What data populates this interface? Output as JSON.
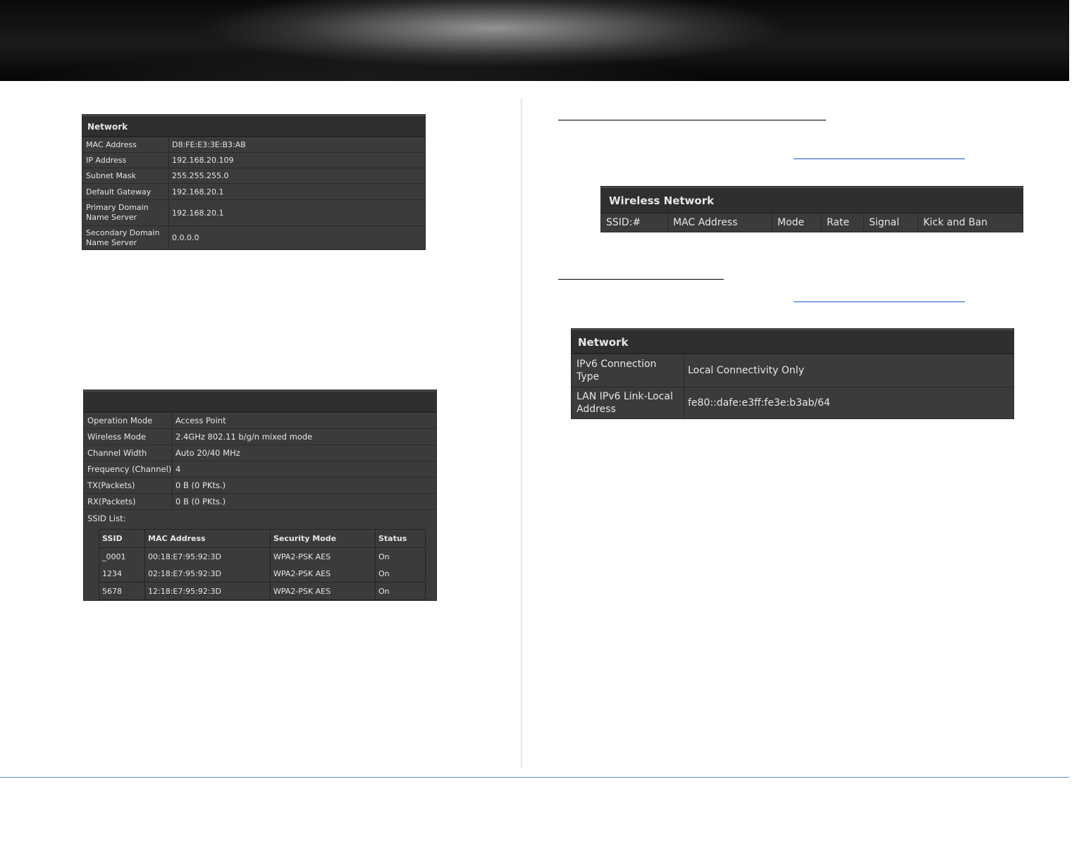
{
  "network_panel": {
    "title": "Network",
    "rows": [
      {
        "label": "MAC Address",
        "value": "D8:FE:E3:3E:B3:AB"
      },
      {
        "label": "IP Address",
        "value": "192.168.20.109"
      },
      {
        "label": "Subnet Mask",
        "value": "255.255.255.0"
      },
      {
        "label": "Default Gateway",
        "value": "192.168.20.1"
      },
      {
        "label": "Primary Domain\nName Server",
        "value": "192.168.20.1"
      },
      {
        "label": "Secondary Domain\nName Server",
        "value": "0.0.0.0"
      }
    ]
  },
  "wireless_panel": {
    "title": "",
    "rows": [
      {
        "label": "Operation Mode",
        "value": "Access Point"
      },
      {
        "label": "Wireless Mode",
        "value": "2.4GHz 802.11 b/g/n mixed mode"
      },
      {
        "label": "Channel Width",
        "value": "Auto 20/40 MHz"
      },
      {
        "label": "Frequency (Channel)",
        "value": "4"
      },
      {
        "label": "TX(Packets)",
        "value": "0 B (0 PKts.)"
      },
      {
        "label": "RX(Packets)",
        "value": "0 B (0 PKts.)"
      }
    ],
    "ssid_list_label": "SSID List:",
    "ssid_columns": [
      "SSID",
      "MAC Address",
      "Security Mode",
      "Status"
    ],
    "ssid_rows": [
      [
        "_0001",
        "00:18:E7:95:92:3D",
        "WPA2-PSK AES",
        "On"
      ],
      [
        "1234",
        "02:18:E7:95:92:3D",
        "WPA2-PSK AES",
        "On"
      ],
      [
        "5678",
        "12:18:E7:95:92:3D",
        "WPA2-PSK AES",
        "On"
      ]
    ]
  },
  "wireless_network_panel": {
    "title": "Wireless Network",
    "columns": [
      "SSID:#",
      "MAC Address",
      "Mode",
      "Rate",
      "Signal",
      "Kick and Ban"
    ]
  },
  "ipv6_panel": {
    "title": "Network",
    "rows": [
      {
        "label": "IPv6 Connection\nType",
        "value": "Local Connectivity Only"
      },
      {
        "label": "LAN IPv6 Link-Local\nAddress",
        "value": "fe80::dafe:e3ff:fe3e:b3ab/64"
      }
    ]
  },
  "colors": {
    "panel_bg": "#3b3b3b",
    "header_bg": "#2f2f2f",
    "link": "#1f4fd1",
    "footer_rule": "#5b8fc7"
  }
}
